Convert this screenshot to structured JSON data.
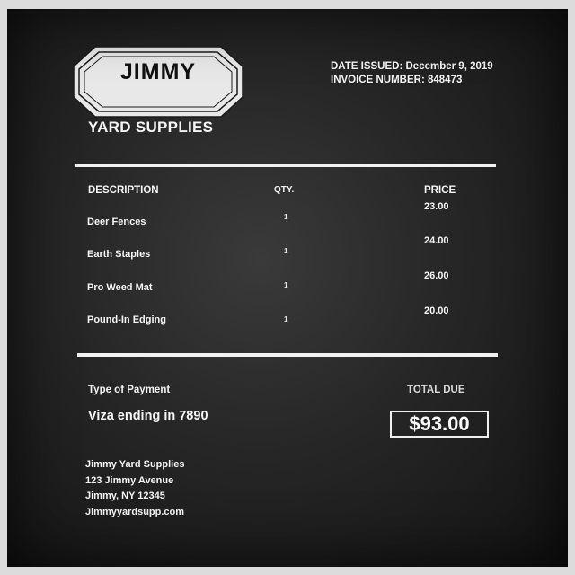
{
  "brand": {
    "logo_name": "JIMMY",
    "subtitle": "YARD SUPPLIES"
  },
  "invoice_meta": {
    "date_issued": "DATE ISSUED: December 9, 2019",
    "invoice_number": "INVOICE NUMBER: 848473"
  },
  "table": {
    "headers": {
      "description": "DESCRIPTION",
      "qty": "QTY.",
      "price": "PRICE"
    },
    "rows": [
      {
        "description": "Deer Fences",
        "qty": "1",
        "price": "23.00"
      },
      {
        "description": "Earth Staples",
        "qty": "1",
        "price": "24.00"
      },
      {
        "description": "Pro Weed Mat",
        "qty": "1",
        "price": "26.00"
      },
      {
        "description": "Pound-In Edging",
        "qty": "1",
        "price": "20.00"
      }
    ]
  },
  "payment": {
    "label": "Type of Payment",
    "value": "Viza ending in 7890"
  },
  "total": {
    "label": "TOTAL DUE",
    "value": "$93.00"
  },
  "address": {
    "line1": "Jimmy Yard Supplies",
    "line2": "123 Jimmy Avenue",
    "line3": "Jimmy, NY 12345",
    "line4": "Jimmyyardsupp.com"
  },
  "colors": {
    "background": "#262626",
    "text": "#f2f2f2",
    "logo_fill": "#e8e8e8"
  }
}
